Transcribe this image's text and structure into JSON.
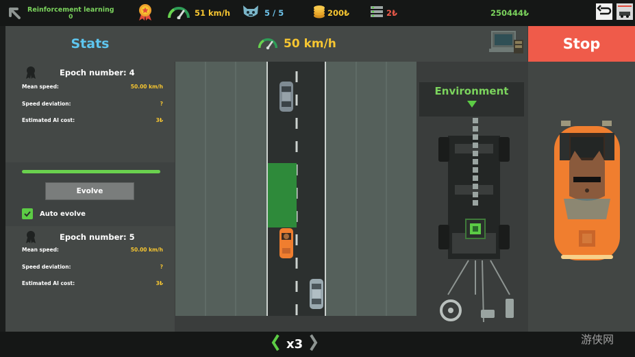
{
  "topbar": {
    "mode_title": "Reinforcement learning",
    "mode_count": "0",
    "speed": "51 km/h",
    "cats": "5 / 5",
    "coins": "200₺",
    "servers": "2₺",
    "balance": "250444₺",
    "icons": [
      "back-arrow-icon",
      "medal-icon",
      "speedometer-icon",
      "cat-face-icon",
      "coins-icon",
      "server-icon",
      "undo-icon",
      "garage-icon"
    ]
  },
  "header": {
    "stats_title": "Stats",
    "speed": "50 km/h",
    "stop_label": "Stop"
  },
  "epochs": [
    {
      "title": "Epoch number: 4",
      "mean_speed_label": "Mean speed:",
      "mean_speed": "50.00 km/h",
      "deviation_label": "Speed deviation:",
      "deviation": "?",
      "cost_label": "Estimated AI cost:",
      "cost": "3₺"
    },
    {
      "title": "Epoch number: 5",
      "mean_speed_label": "Mean speed:",
      "mean_speed": "50.00 km/h",
      "deviation_label": "Speed deviation:",
      "deviation": "?",
      "cost_label": "Estimated AI cost:",
      "cost": "3₺"
    }
  ],
  "training": {
    "progress": 1.0,
    "evolve_label": "Evolve",
    "auto_evolve_label": "Auto evolve",
    "auto_evolve_checked": true
  },
  "environment": {
    "label": "Environment"
  },
  "bottom": {
    "speed_multiplier": "x3"
  },
  "watermark": "游侠网",
  "colors": {
    "accent_green": "#7bd35d",
    "stop_red": "#ef5b4a",
    "title_blue": "#5ec6ef",
    "value_yellow": "#f7c631",
    "player_car": "#f07e2f"
  }
}
